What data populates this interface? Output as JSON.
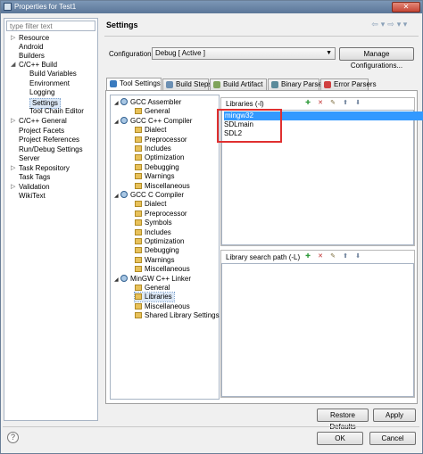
{
  "window": {
    "title": "Properties for Test1"
  },
  "nav": {
    "filter_placeholder": "type filter text",
    "items": [
      {
        "label": "Resource",
        "tw": "▷"
      },
      {
        "label": "Android",
        "tw": ""
      },
      {
        "label": "Builders",
        "tw": ""
      },
      {
        "label": "C/C++ Build",
        "tw": "◢"
      },
      {
        "label": "Build Variables",
        "tw": ""
      },
      {
        "label": "Environment",
        "tw": ""
      },
      {
        "label": "Logging",
        "tw": ""
      },
      {
        "label": "Settings",
        "tw": ""
      },
      {
        "label": "Tool Chain Editor",
        "tw": ""
      },
      {
        "label": "C/C++ General",
        "tw": "▷"
      },
      {
        "label": "Project Facets",
        "tw": ""
      },
      {
        "label": "Project References",
        "tw": ""
      },
      {
        "label": "Run/Debug Settings",
        "tw": ""
      },
      {
        "label": "Server",
        "tw": ""
      },
      {
        "label": "Task Repository",
        "tw": "▷"
      },
      {
        "label": "Task Tags",
        "tw": ""
      },
      {
        "label": "Validation",
        "tw": "▷"
      },
      {
        "label": "WikiText",
        "tw": ""
      }
    ]
  },
  "page": {
    "title": "Settings",
    "nav_arrows": [
      "⇦",
      "▾",
      "⇨",
      "▾",
      "▾"
    ],
    "config_label": "Configuration:",
    "config_value": "Debug  [ Active ]",
    "manage_button": "Manage Configurations..."
  },
  "tabs": [
    {
      "label": "Tool Settings",
      "active": true,
      "color": "#3a7bbf"
    },
    {
      "label": "Build Steps",
      "active": false,
      "color": "#6b8fb3"
    },
    {
      "label": "Build Artifact",
      "active": false,
      "color": "#7fa35a"
    },
    {
      "label": "Binary Parsers",
      "active": false,
      "color": "#5a8a9a"
    },
    {
      "label": "Error Parsers",
      "active": false,
      "color": "#d04040"
    }
  ],
  "tree": {
    "tool_twisty": "◢",
    "tools": [
      {
        "label": "GCC Assembler",
        "children": [
          "General"
        ]
      },
      {
        "label": "GCC C++ Compiler",
        "children": [
          "Dialect",
          "Preprocessor",
          "Includes",
          "Optimization",
          "Debugging",
          "Warnings",
          "Miscellaneous"
        ]
      },
      {
        "label": "GCC C Compiler",
        "children": [
          "Dialect",
          "Preprocessor",
          "Symbols",
          "Includes",
          "Optimization",
          "Debugging",
          "Warnings",
          "Miscellaneous"
        ]
      },
      {
        "label": "MinGW C++ Linker",
        "children": [
          "General",
          "Libraries",
          "Miscellaneous",
          "Shared Library Settings"
        ]
      }
    ]
  },
  "libraries": {
    "title": "Libraries (-l)",
    "items": [
      "mingw32",
      "SDLmain",
      "SDL2"
    ],
    "selected": 0,
    "tool_icons": [
      "✚",
      "✕",
      "✎",
      "⬆",
      "⬇"
    ]
  },
  "search_path": {
    "title": "Library search path (-L)",
    "tool_icons": [
      "✚",
      "✕",
      "✎",
      "⬆",
      "⬇"
    ]
  },
  "buttons": {
    "restore": "Restore Defaults",
    "apply": "Apply",
    "ok": "OK",
    "cancel": "Cancel"
  },
  "help_icon": "?",
  "close_glyph": "✕",
  "colors": {
    "selection": "#3399ff",
    "highlight_box": "#e03030"
  }
}
